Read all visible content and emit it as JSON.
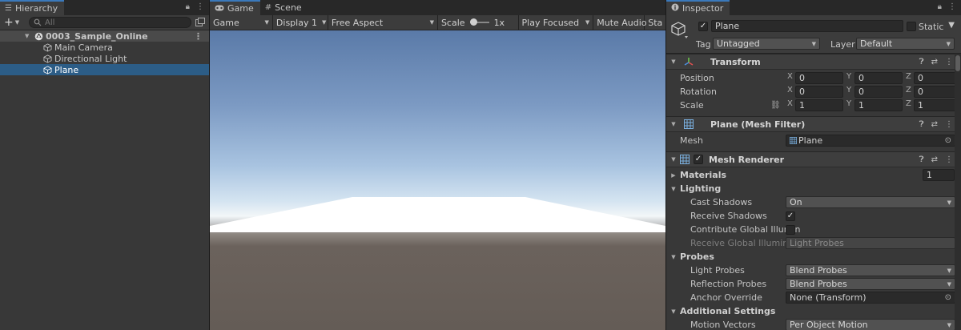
{
  "hierarchy": {
    "tab_label": "Hierarchy",
    "search_placeholder": "All",
    "scene_name": "0003_Sample_Online",
    "objects": [
      {
        "name": "Main Camera",
        "selected": false
      },
      {
        "name": "Directional Light",
        "selected": false
      },
      {
        "name": "Plane",
        "selected": true
      }
    ]
  },
  "game": {
    "tabs": [
      {
        "label": "Game"
      },
      {
        "label": "Scene"
      }
    ],
    "toolbar": {
      "view_mode": "Game",
      "display": "Display 1",
      "aspect": "Free Aspect",
      "scale_label": "Scale",
      "scale_value": "1x",
      "play_mode": "Play Focused",
      "mute_audio": "Mute Audio",
      "stats": "Sta"
    }
  },
  "inspector": {
    "tab_label": "Inspector",
    "object_name": "Plane",
    "static_label": "Static",
    "tag_label": "Tag",
    "tag_value": "Untagged",
    "layer_label": "Layer",
    "layer_value": "Default",
    "transform": {
      "title": "Transform",
      "rows": [
        {
          "label": "Position",
          "x": "0",
          "y": "0",
          "z": "0"
        },
        {
          "label": "Rotation",
          "x": "0",
          "y": "0",
          "z": "0"
        },
        {
          "label": "Scale",
          "x": "1",
          "y": "1",
          "z": "1"
        }
      ],
      "axis": {
        "x": "X",
        "y": "Y",
        "z": "Z"
      }
    },
    "mesh_filter": {
      "title": "Plane (Mesh Filter)",
      "mesh_label": "Mesh",
      "mesh_value": "Plane"
    },
    "mesh_renderer": {
      "title": "Mesh Renderer",
      "materials_label": "Materials",
      "materials_count": "1",
      "lighting_label": "Lighting",
      "cast_shadows_label": "Cast Shadows",
      "cast_shadows_value": "On",
      "receive_shadows_label": "Receive Shadows",
      "contribute_gi_label": "Contribute Global Illumin",
      "receive_gi_label": "Receive Global Illuminati",
      "receive_gi_value": "Light Probes",
      "probes_label": "Probes",
      "light_probes_label": "Light Probes",
      "light_probes_value": "Blend Probes",
      "reflection_probes_label": "Reflection Probes",
      "reflection_probes_value": "Blend Probes",
      "anchor_override_label": "Anchor Override",
      "anchor_override_value": "None (Transform)",
      "additional_settings_label": "Additional Settings",
      "motion_vectors_label": "Motion Vectors",
      "motion_vectors_value": "Per Object Motion"
    }
  },
  "colors": {
    "selection": "#2c5d87",
    "panel": "#383838",
    "tab_accent": "#3a79bb"
  }
}
